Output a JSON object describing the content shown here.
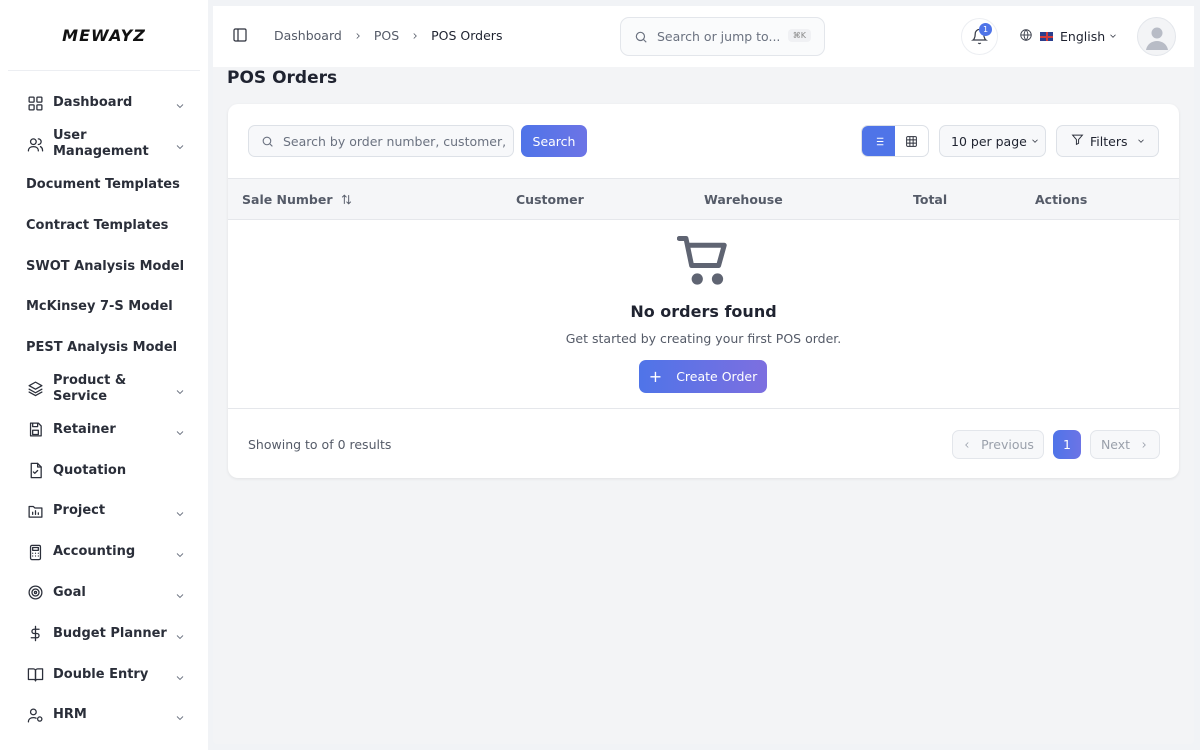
{
  "app": {
    "logo": "MEWAYZ"
  },
  "sidebar": {
    "items": [
      {
        "label": "Dashboard",
        "icon": "dashboard-grid-icon",
        "has_chevron": true
      },
      {
        "label": "User Management",
        "icon": "users-icon",
        "has_chevron": true
      },
      {
        "label": "Document Templates",
        "icon": "",
        "has_chevron": false
      },
      {
        "label": "Contract Templates",
        "icon": "",
        "has_chevron": false
      },
      {
        "label": "SWOT Analysis Model",
        "icon": "",
        "has_chevron": false
      },
      {
        "label": "McKinsey 7-S Model",
        "icon": "",
        "has_chevron": false
      },
      {
        "label": "PEST Analysis Model",
        "icon": "",
        "has_chevron": false
      },
      {
        "label": "Product & Service",
        "icon": "layers-icon",
        "has_chevron": true
      },
      {
        "label": "Retainer",
        "icon": "save-icon",
        "has_chevron": true
      },
      {
        "label": "Quotation",
        "icon": "file-check-icon",
        "has_chevron": false
      },
      {
        "label": "Project",
        "icon": "folder-chart-icon",
        "has_chevron": true
      },
      {
        "label": "Accounting",
        "icon": "calculator-icon",
        "has_chevron": true
      },
      {
        "label": "Goal",
        "icon": "target-icon",
        "has_chevron": true
      },
      {
        "label": "Budget Planner",
        "icon": "dollar-icon",
        "has_chevron": true
      },
      {
        "label": "Double Entry",
        "icon": "book-open-icon",
        "has_chevron": true
      },
      {
        "label": "HRM",
        "icon": "user-cog-icon",
        "has_chevron": true
      }
    ]
  },
  "topbar": {
    "breadcrumb": [
      "Dashboard",
      "POS",
      "POS Orders"
    ],
    "search_placeholder": "Search or jump to...",
    "search_shortcut": "⌘K",
    "notification_count": "1",
    "language": "English"
  },
  "page": {
    "title": "POS Orders"
  },
  "filters": {
    "search_placeholder": "Search by order number, customer, w",
    "search_button": "Search",
    "per_page": "10 per page",
    "filters_label": "Filters"
  },
  "table": {
    "columns": [
      "Sale Number",
      "Customer",
      "Warehouse",
      "Total",
      "Actions"
    ],
    "rows": []
  },
  "empty_state": {
    "title": "No orders found",
    "subtitle": "Get started by creating your first POS order.",
    "button": "Create Order"
  },
  "pagination": {
    "summary": "Showing to of 0 results",
    "previous": "Previous",
    "current_page": "1",
    "next": "Next"
  },
  "colors": {
    "accent": "#4f74e8",
    "accent_end": "#7d6fe0"
  }
}
